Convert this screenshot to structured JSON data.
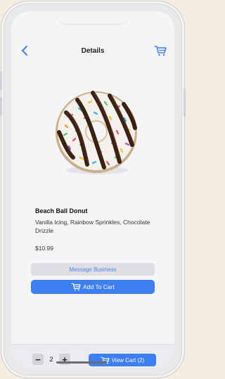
{
  "header": {
    "title": "Details",
    "back_icon": "chevron-left-icon",
    "cart_icon": "cart-icon"
  },
  "product": {
    "name": "Beach Ball Donut",
    "description": "Vanilla Icing, Rainbow Sprinkles, Chocolate Drizzle",
    "price": "$10.99",
    "image": "donut-photo"
  },
  "actions": {
    "message_label": "Message Business",
    "add_to_cart_label": "Add To Cart"
  },
  "bottom_bar": {
    "quantity": "2",
    "minus": "−",
    "plus": "+",
    "view_cart_label": "View Cart (2)"
  },
  "colors": {
    "accent": "#3d7ef0",
    "background": "#f5f5f7"
  }
}
